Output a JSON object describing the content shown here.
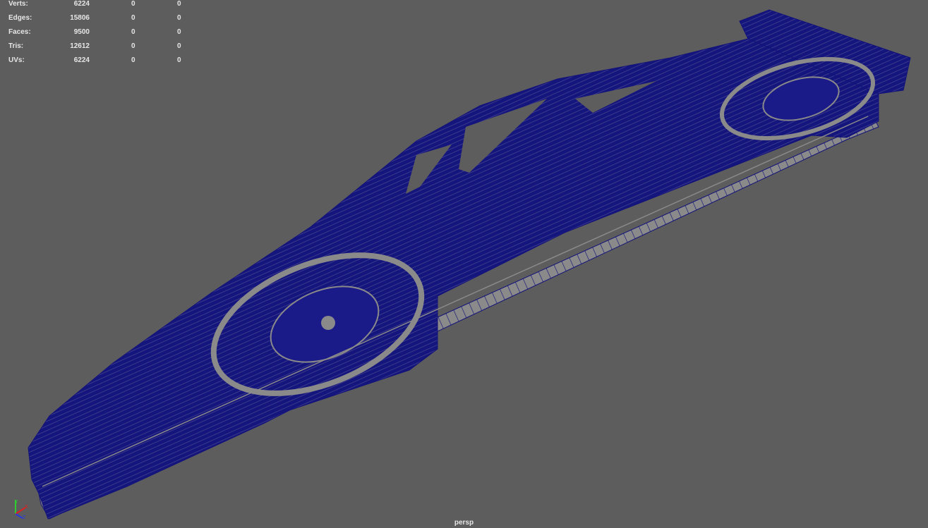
{
  "hud": {
    "rows": [
      {
        "label": "Verts:",
        "values": [
          "6224",
          "0",
          "0"
        ]
      },
      {
        "label": "Edges:",
        "values": [
          "15806",
          "0",
          "0"
        ]
      },
      {
        "label": "Faces:",
        "values": [
          "9500",
          "0",
          "0"
        ]
      },
      {
        "label": "Tris:",
        "values": [
          "12612",
          "0",
          "0"
        ]
      },
      {
        "label": "UVs:",
        "values": [
          "6224",
          "0",
          "0"
        ]
      }
    ]
  },
  "viewport": {
    "camera_label": "persp",
    "background": "#5d5d5d",
    "wire_color": "#12127a",
    "face_color": "#8c8c8c"
  },
  "axis": {
    "x": "X",
    "y": "Y",
    "z": "Z"
  }
}
